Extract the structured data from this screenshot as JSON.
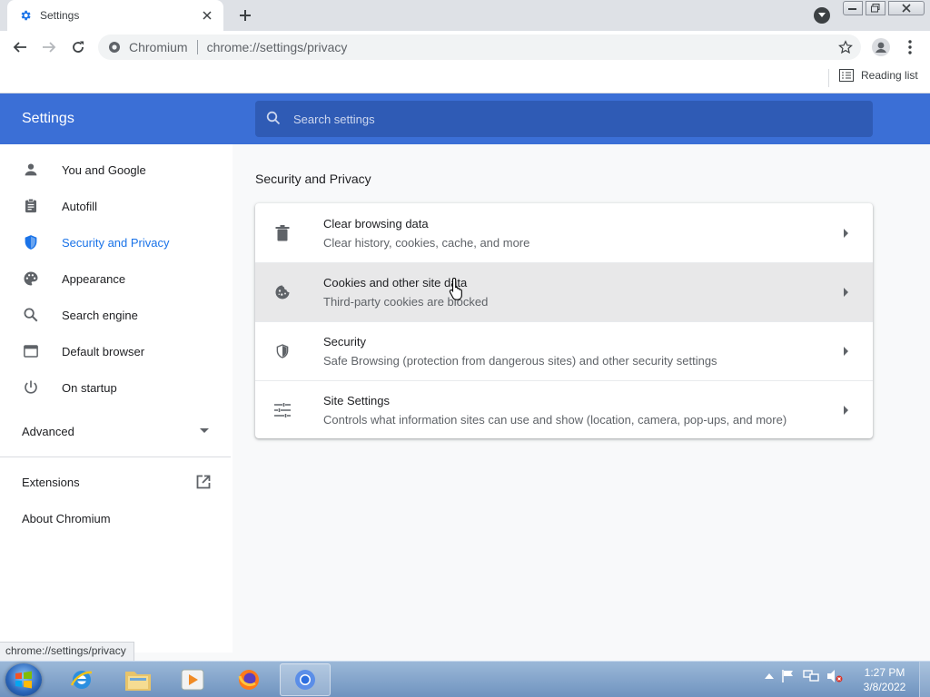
{
  "browser": {
    "tab_title": "Settings",
    "omnibox_site": "Chromium",
    "omnibox_url": "chrome://settings/privacy",
    "reading_list": "Reading list"
  },
  "settings": {
    "header_title": "Settings",
    "search_placeholder": "Search settings",
    "sidebar": {
      "items": [
        {
          "label": "You and Google",
          "icon": "person-icon"
        },
        {
          "label": "Autofill",
          "icon": "clipboard-icon"
        },
        {
          "label": "Security and Privacy",
          "icon": "shield-icon",
          "active": true
        },
        {
          "label": "Appearance",
          "icon": "palette-icon"
        },
        {
          "label": "Search engine",
          "icon": "search-icon"
        },
        {
          "label": "Default browser",
          "icon": "browser-window-icon"
        },
        {
          "label": "On startup",
          "icon": "power-icon"
        }
      ],
      "advanced": "Advanced",
      "extensions": "Extensions",
      "about": "About Chromium"
    },
    "section_title": "Security and Privacy",
    "rows": [
      {
        "title": "Clear browsing data",
        "subtitle": "Clear history, cookies, cache, and more",
        "icon": "trash-icon"
      },
      {
        "title": "Cookies and other site data",
        "subtitle": "Third-party cookies are blocked",
        "icon": "cookie-icon",
        "hovered": true
      },
      {
        "title": "Security",
        "subtitle": "Safe Browsing (protection from dangerous sites) and other security settings",
        "icon": "shield-icon"
      },
      {
        "title": "Site Settings",
        "subtitle": "Controls what information sites can use and show (location, camera, pop-ups, and more)",
        "icon": "tune-icon"
      }
    ]
  },
  "status_bar": "chrome://settings/privacy",
  "taskbar": {
    "time": "1:27 PM",
    "date": "3/8/2022"
  },
  "colors": {
    "header_blue": "#3b6fd6",
    "active_blue": "#1a73e8"
  }
}
